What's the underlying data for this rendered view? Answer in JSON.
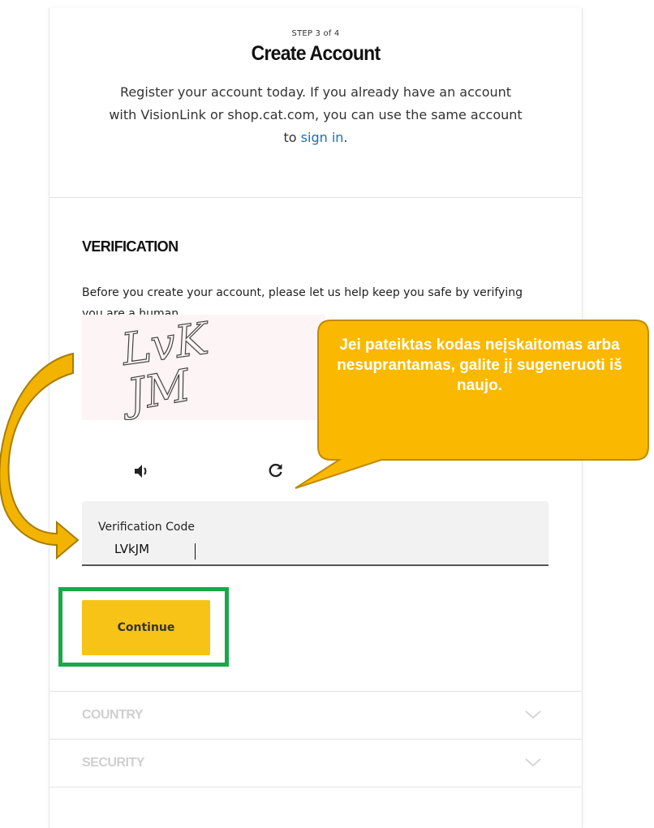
{
  "header": {
    "step": "STEP 3 of 4",
    "title": "Create Account",
    "intro_before": "Register your account today. If you already have an account with VisionLink or shop.cat.com, you can use the same account to ",
    "intro_link": "sign in",
    "intro_after": "."
  },
  "verification": {
    "title": "VERIFICATION",
    "description": "Before you create your account, please let us help keep you safe by verifying you are a human.",
    "captcha_line1": "LvK",
    "captcha_line2": "JM",
    "field_label": "Verification Code",
    "field_value": "LVkJM",
    "continue_label": "Continue"
  },
  "collapsed_sections": [
    {
      "title": "COUNTRY"
    },
    {
      "title": "SECURITY"
    }
  ],
  "callout": {
    "text": "Jei pateiktas kodas neįskaitomas arba nesuprantamas, galite jį sugeneruoti iš naujo."
  },
  "colors": {
    "accent_yellow": "#f6c316",
    "callout_fill": "#fbb800",
    "highlight_green": "#18a84a",
    "link": "#1a6fb5"
  },
  "icons": [
    "volume-icon",
    "refresh-icon",
    "chevron-down-icon"
  ]
}
